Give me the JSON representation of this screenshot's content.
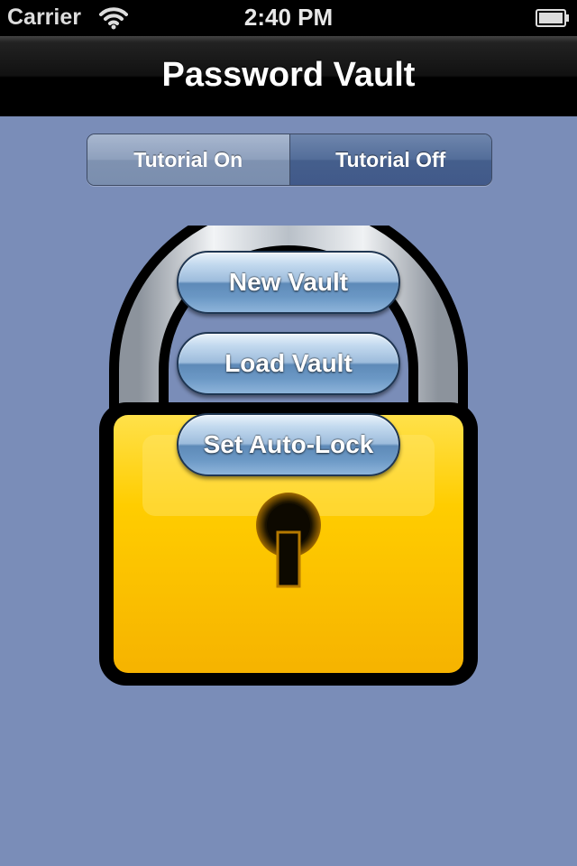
{
  "status_bar": {
    "carrier": "Carrier",
    "time": "2:40 PM",
    "wifi_icon": "wifi-icon",
    "battery_icon": "battery-icon"
  },
  "nav_bar": {
    "title": "Password Vault"
  },
  "tutorial_toggle": {
    "on_label": "Tutorial On",
    "off_label": "Tutorial Off",
    "selected": "Tutorial Off"
  },
  "illustration": {
    "icon": "padlock-icon",
    "body_color": "#ffc400",
    "shackle_color": "#c8ced6"
  },
  "menu": {
    "new_vault_label": "New Vault",
    "load_vault_label": "Load Vault",
    "auto_lock_label": "Set Auto-Lock"
  },
  "colors": {
    "background": "#7a8db8",
    "nav_bar": "#000000",
    "button_blue": "#6b98c5"
  }
}
